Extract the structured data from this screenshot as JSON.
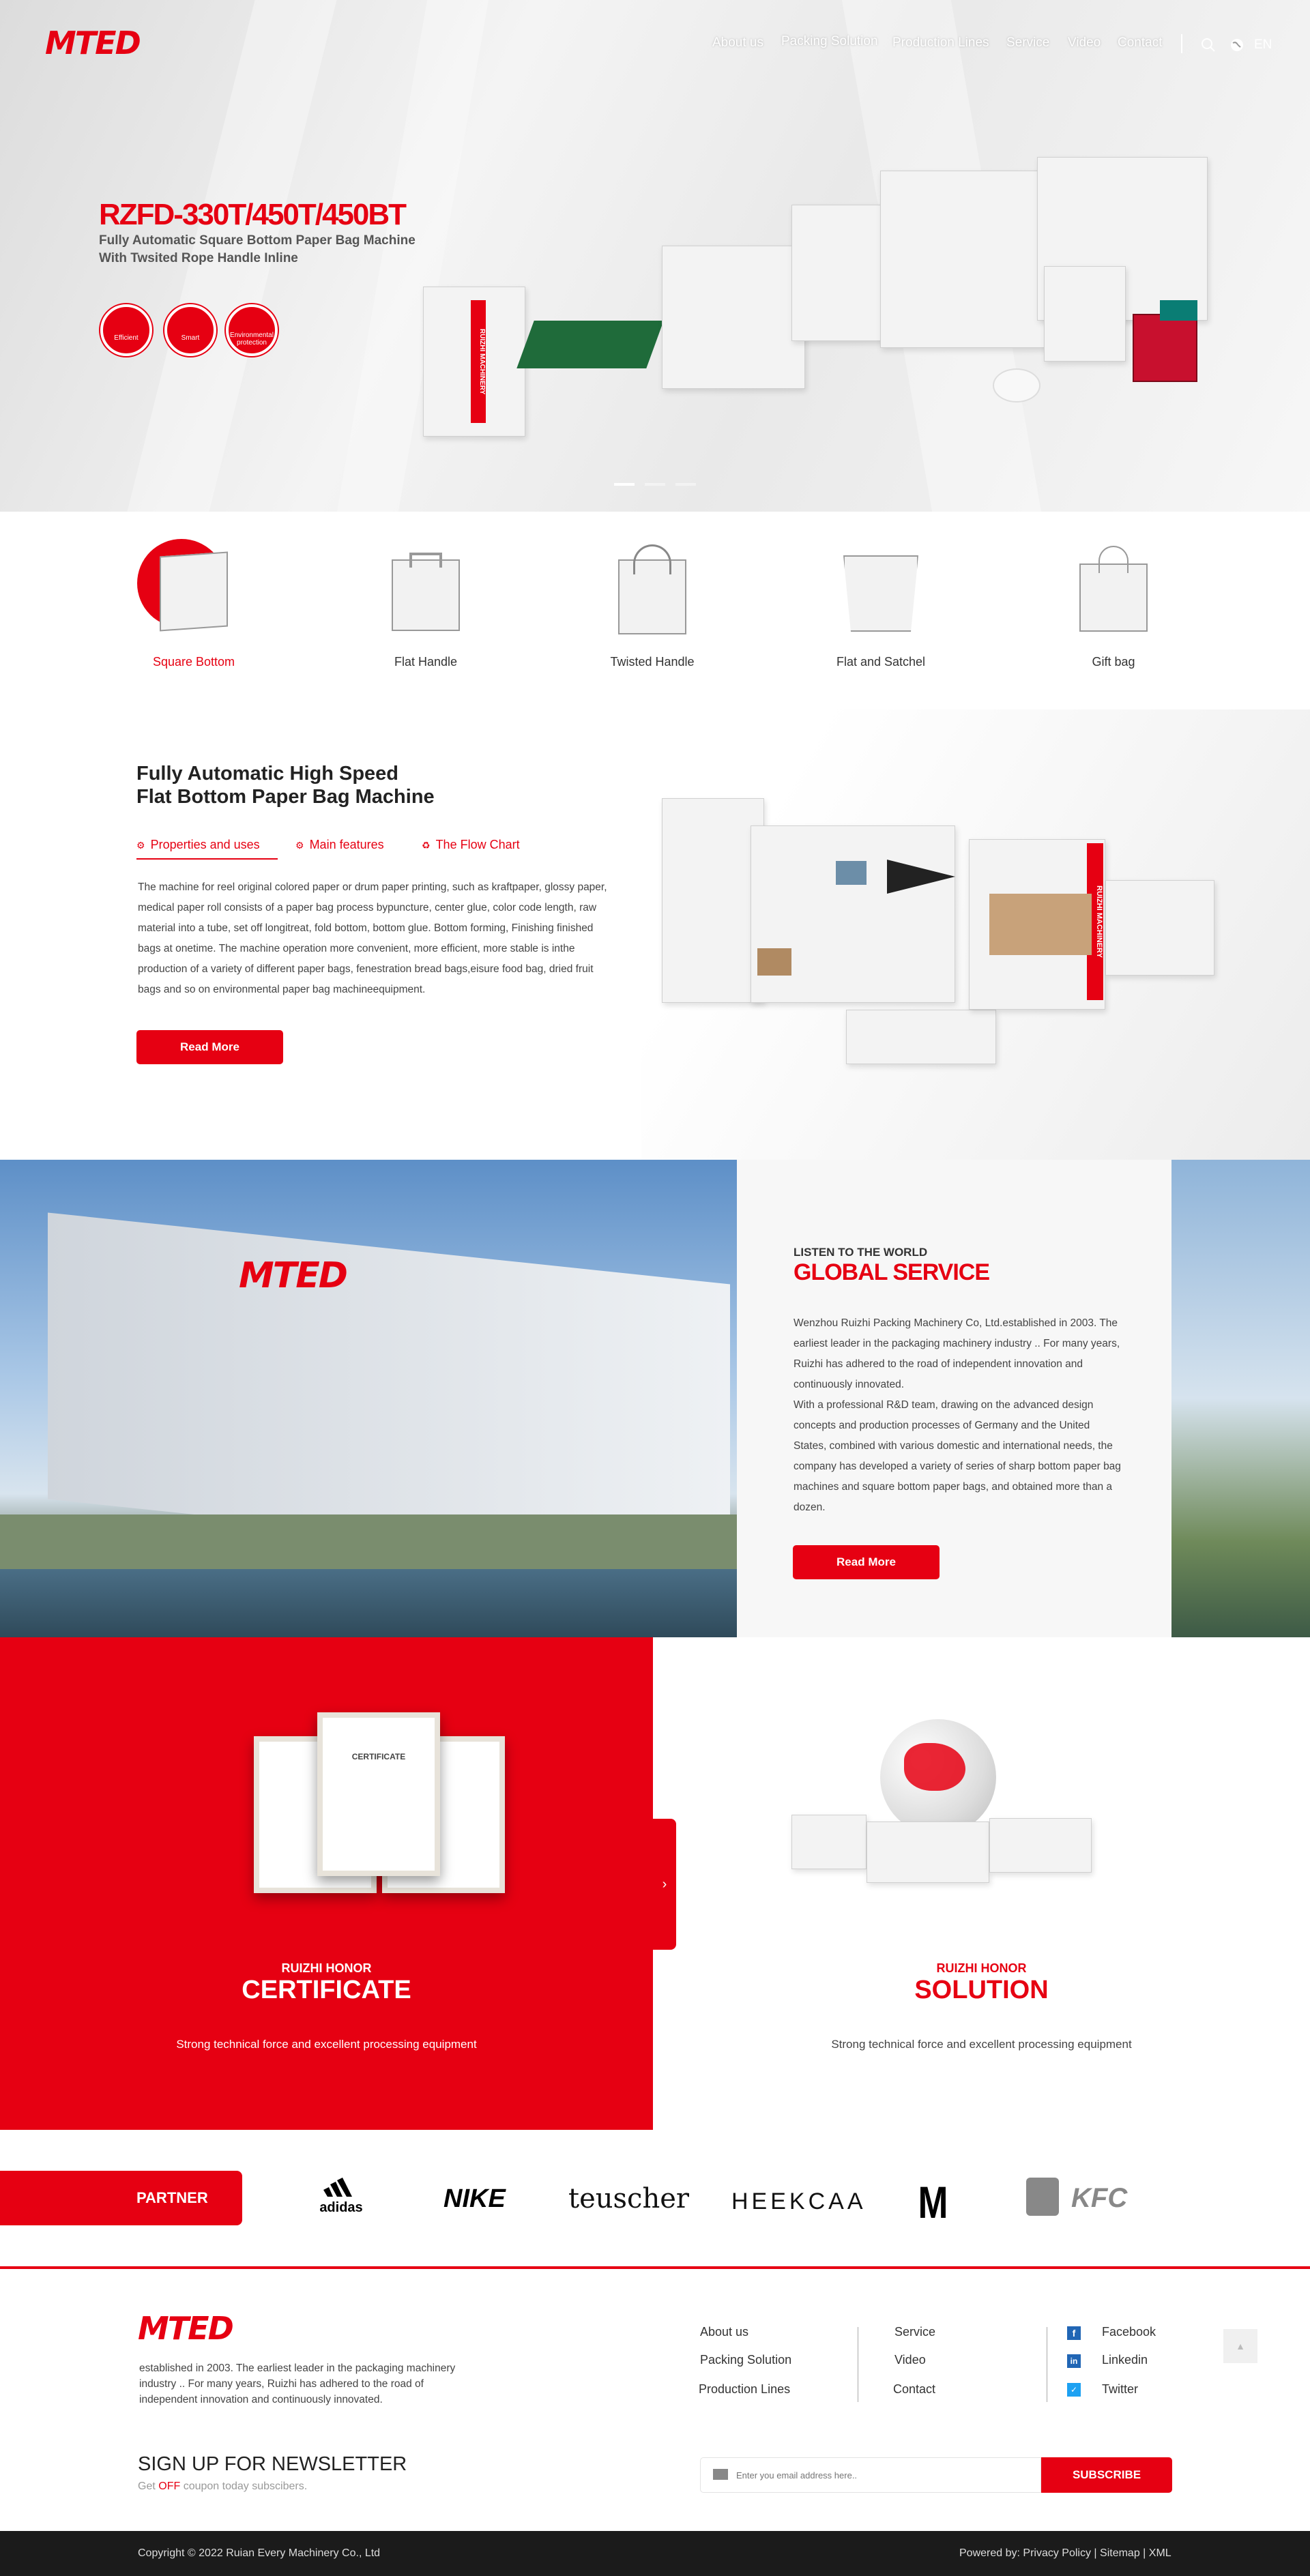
{
  "header": {
    "logo_text": "MTED",
    "nav": [
      "About us",
      "Packing Solution",
      "Production Lines",
      "Service",
      "Video",
      "Contact"
    ],
    "lang": "EN"
  },
  "hero": {
    "model": "RZFD-330T/450T/450BT",
    "subtitle_1": "Fully Automatic Square Bottom Paper Bag Machine",
    "subtitle_2": "With Twsited Rope Handle Inline",
    "badges": [
      "Efficient",
      "Smart",
      "Environmental protection"
    ],
    "machine_brand": "RUIZHI MACHINERY"
  },
  "bag_types": [
    "Square Bottom",
    "Flat Handle",
    "Twisted Handle",
    "Flat and Satchel",
    "Gift bag"
  ],
  "machine_section": {
    "title_1": "Fully Automatic High Speed",
    "title_2": "Flat Bottom Paper Bag Machine",
    "tabs": [
      "Properties and uses",
      "Main features",
      "The Flow Chart"
    ],
    "description": "The machine for reel original colored paper or drum paper printing, such as kraftpaper, glossy paper, medical paper roll consists of a paper bag process bypuncture, center glue, color code length, raw material into a tube, set off longitreat, fold bottom, bottom glue. Bottom forming, Finishing finished bags at onetime. The machine operation more convenient, more efficient, more stable is inthe production of a variety of different paper bags, fenestration bread bags,eisure food bag, dried fruit bags and so on environmental paper bag machineequipment.",
    "read_more": "Read More",
    "machine_brand": "RUIZHI MACHINERY"
  },
  "global": {
    "kicker": "LISTEN TO THE WORLD",
    "title": "GLOBAL SERVICE",
    "para_1": "Wenzhou Ruizhi Packing Machinery Co, Ltd.established in 2003. The earliest leader in the packaging machinery industry .. For many years, Ruizhi has adhered to the road of independent innovation and continuously innovated.",
    "para_2": "With a professional R&D team, drawing on the advanced design concepts and production processes of Germany and the United States, combined with various domestic and international needs, the company has developed a variety of series of sharp bottom paper bag machines and square bottom paper bags, and obtained more than a dozen.",
    "read_more": "Read More",
    "building_sign": "MTED"
  },
  "honor": {
    "left_kicker": "RUIZHI HONOR",
    "left_title": "CERTIFICATE",
    "left_desc": "Strong technical force and excellent processing equipment",
    "cert_heading": "CERTIFICATE",
    "right_kicker": "RUIZHI HONOR",
    "right_title": "SOLUTION",
    "right_desc": "Strong technical force and excellent processing equipment"
  },
  "partners": {
    "label": "PARTNER",
    "logos": [
      "adidas",
      "NIKE",
      "teuscher",
      "HEEKCAA",
      "M",
      "KFC"
    ]
  },
  "footer": {
    "logo_text": "MTED",
    "about": "established in 2003. The earliest leader in the packaging machinery industry .. For many years, Ruizhi has adhered to the road of independent innovation and continuously innovated.",
    "links_col1": [
      "About us",
      "Packing Solution",
      "Production Lines"
    ],
    "links_col2": [
      "Service",
      "Video",
      "Contact"
    ],
    "social": [
      "Facebook",
      "Linkedin",
      "Twitter"
    ],
    "newsletter_title": "SIGN UP FOR NEWSLETTER",
    "newsletter_sub_pre": "Get",
    "newsletter_sub_hl": "OFF",
    "newsletter_sub_post": "coupon today subscibers.",
    "email_placeholder": "Enter you email address here..",
    "subscribe": "SUBSCRIBE"
  },
  "copyright": {
    "text": "Copyright © 2022 Ruian Every Machinery Co., Ltd",
    "powered": "Powered by:",
    "links": [
      "Privacy Policy",
      "Sitemap",
      "XML"
    ]
  },
  "colors": {
    "brand_red": "#e60012",
    "dark": "#1b1b1b"
  }
}
